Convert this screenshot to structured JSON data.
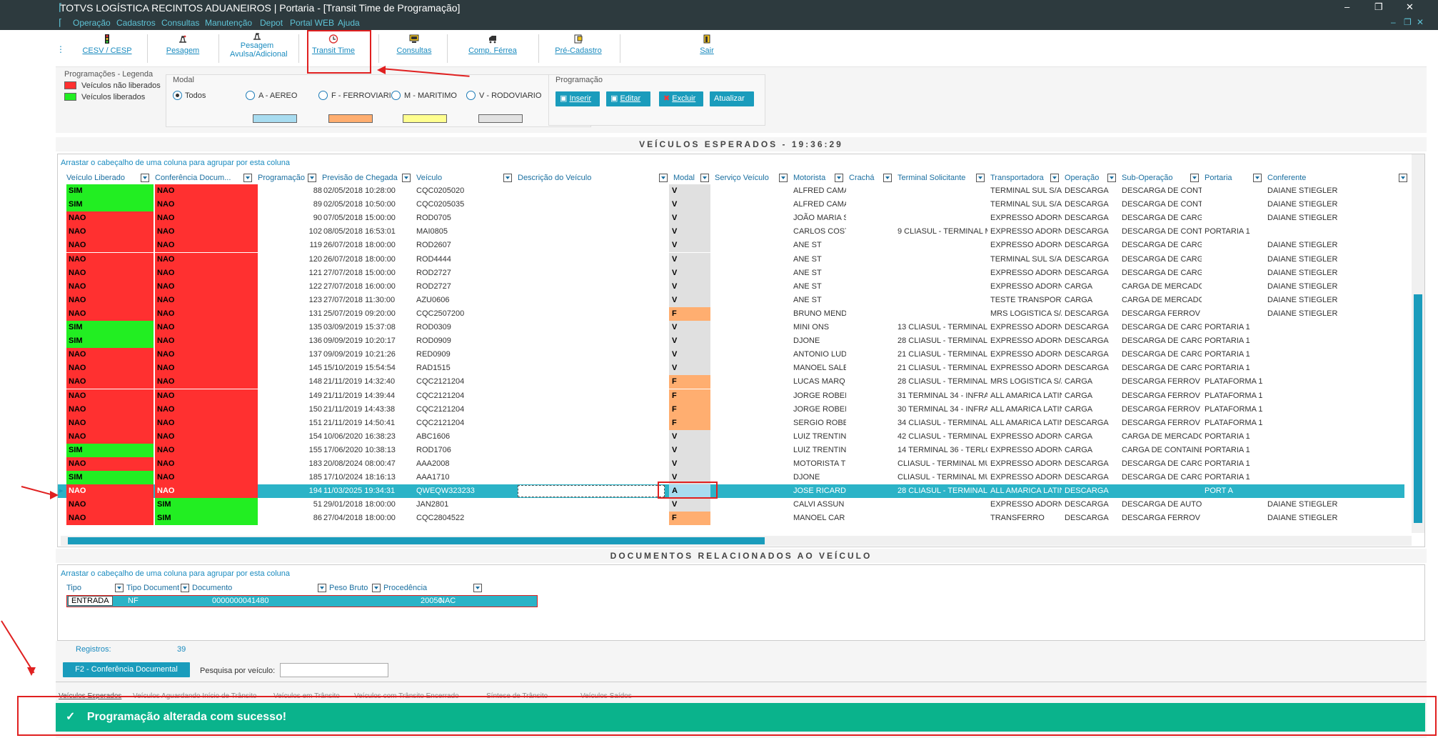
{
  "window": {
    "title": "TOTVS LOGÍSTICA RECINTOS ADUANEIROS | Portaria - [Transit Time de Programação]",
    "min": "–",
    "max": "❐",
    "close": "✕"
  },
  "menu": [
    "Operação",
    "Cadastros",
    "Consultas",
    "Manutenção",
    "Depot",
    "Portal WEB",
    "Ajuda"
  ],
  "toolbar": [
    {
      "label": "CESV / CESP",
      "icon": "traffic-light-icon"
    },
    {
      "label": "Pesagem",
      "icon": "scale-icon"
    },
    {
      "label": "Pesagem Avulsa/Adicional",
      "icon": "scale-icon"
    },
    {
      "label": "Transit Time",
      "icon": "clock-icon"
    },
    {
      "label": "Consultas",
      "icon": "monitor-icon"
    },
    {
      "label": "Comp. Férrea",
      "icon": "train-icon"
    },
    {
      "label": "Pré-Cadastro",
      "icon": "form-icon"
    },
    {
      "label": "Sair",
      "icon": "exit-icon"
    }
  ],
  "legend": {
    "title": "Programações - Legenda",
    "not_released": "Veículos não liberados",
    "released": "Veículos liberados",
    "red": "#ff3030",
    "green": "#22ee22"
  },
  "modal": {
    "title": "Modal",
    "options": [
      "Todos",
      "A - AEREO",
      "F - FERROVIARIO",
      "M - MARITIMO",
      "V - RODOVIARIO"
    ],
    "selected": "Todos",
    "colors": [
      "#a8dcf0",
      "#ffae70",
      "#ffff90",
      "#e2e2e2"
    ]
  },
  "programacao": {
    "title": "Programação",
    "insert": "Inserir",
    "edit": "Editar",
    "delete": "Excluir",
    "refresh": "Atualizar"
  },
  "vehicles_header": "VEÍCULOS ESPERADOS - 19:36:29",
  "group_hint": "Arrastar o cabeçalho de uma coluna para agrupar por esta coluna",
  "columns": [
    "Veículo Liberado",
    "Conferência Docum...",
    "Programação",
    "Previsão de Chegada",
    "Veículo",
    "Descrição do Veículo",
    "Modal",
    "Serviço Veículo",
    "Motorista",
    "Crachá",
    "Terminal Solicitante",
    "Transportadora",
    "Operação",
    "Sub-Operação",
    "Portaria",
    "Conferente"
  ],
  "rows": [
    [
      "SIM",
      "NAO",
      "88",
      "02/05/2018 10:28:00",
      "CQC0205020",
      "",
      "V",
      "",
      "ALFRED CAMA",
      "",
      "",
      "TERMINAL SUL S/A",
      "DESCARGA",
      "DESCARGA DE CONTI",
      "",
      "DAIANE STIEGLER"
    ],
    [
      "SIM",
      "NAO",
      "89",
      "02/05/2018 10:50:00",
      "CQC0205035",
      "",
      "V",
      "",
      "ALFRED CAMA",
      "",
      "",
      "TERMINAL SUL S/A",
      "DESCARGA",
      "DESCARGA DE CONTI",
      "",
      "DAIANE STIEGLER"
    ],
    [
      "NAO",
      "NAO",
      "90",
      "07/05/2018 15:00:00",
      "ROD0705",
      "",
      "V",
      "",
      "JOÃO MARIA S",
      "",
      "",
      "EXPRESSO ADORN",
      "DESCARGA",
      "DESCARGA DE CARGA",
      "",
      "DAIANE STIEGLER"
    ],
    [
      "NAO",
      "NAO",
      "102",
      "08/05/2018 16:53:01",
      "MAI0805",
      "",
      "V",
      "",
      "CARLOS COST",
      "",
      "9 CLIASUL - TERMINAL MU",
      "EXPRESSO ADORN",
      "DESCARGA",
      "DESCARGA DE CONTI",
      "PORTARIA 1",
      ""
    ],
    [
      "NAO",
      "NAO",
      "119",
      "26/07/2018 18:00:00",
      "ROD2607",
      "",
      "V",
      "",
      "ANE ST",
      "",
      "",
      "EXPRESSO ADORN",
      "DESCARGA",
      "DESCARGA DE CARGA",
      "",
      "DAIANE STIEGLER"
    ],
    [
      "NAO",
      "NAO",
      "120",
      "26/07/2018 18:00:00",
      "ROD4444",
      "",
      "V",
      "",
      "ANE ST",
      "",
      "",
      "TERMINAL SUL S/A",
      "DESCARGA",
      "DESCARGA DE CARGA",
      "",
      "DAIANE STIEGLER"
    ],
    [
      "NAO",
      "NAO",
      "121",
      "27/07/2018 15:00:00",
      "ROD2727",
      "",
      "V",
      "",
      "ANE ST",
      "",
      "",
      "EXPRESSO ADORN",
      "DESCARGA",
      "DESCARGA DE CARGA",
      "",
      "DAIANE STIEGLER"
    ],
    [
      "NAO",
      "NAO",
      "122",
      "27/07/2018 16:00:00",
      "ROD2727",
      "",
      "V",
      "",
      "ANE ST",
      "",
      "",
      "EXPRESSO ADORN",
      "CARGA",
      "CARGA DE MERCADO",
      "",
      "DAIANE STIEGLER"
    ],
    [
      "NAO",
      "NAO",
      "123",
      "27/07/2018 11:30:00",
      "AZU0606",
      "",
      "V",
      "",
      "ANE ST",
      "",
      "",
      "TESTE TRANSPORT",
      "CARGA",
      "CARGA DE MERCADO",
      "",
      "DAIANE STIEGLER"
    ],
    [
      "NAO",
      "NAO",
      "131",
      "25/07/2019 09:20:00",
      "CQC2507200",
      "",
      "F",
      "",
      "BRUNO MEND",
      "",
      "",
      "MRS LOGISTICA S/A",
      "DESCARGA",
      "DESCARGA FERROV I",
      "",
      "DAIANE STIEGLER"
    ],
    [
      "SIM",
      "NAO",
      "135",
      "03/09/2019 15:37:08",
      "ROD0309",
      "",
      "V",
      "",
      "MINI ONS",
      "",
      "13 CLIASUL - TERMINAL MU",
      "EXPRESSO ADORN",
      "DESCARGA",
      "DESCARGA DE CARGA",
      "PORTARIA 1",
      ""
    ],
    [
      "SIM",
      "NAO",
      "136",
      "09/09/2019 10:20:17",
      "ROD0909",
      "",
      "V",
      "",
      "DJONE",
      "",
      "28 CLIASUL - TERMINAL MU",
      "EXPRESSO ADORN",
      "DESCARGA",
      "DESCARGA DE CARGA",
      "PORTARIA 1",
      ""
    ],
    [
      "NAO",
      "NAO",
      "137",
      "09/09/2019 10:21:26",
      "RED0909",
      "",
      "V",
      "",
      "ANTONIO LUD",
      "",
      "21 CLIASUL - TERMINAL MU",
      "EXPRESSO ADORN",
      "DESCARGA",
      "DESCARGA DE CARGA",
      "PORTARIA 1",
      ""
    ],
    [
      "NAO",
      "NAO",
      "145",
      "15/10/2019 15:54:54",
      "RAD1515",
      "",
      "V",
      "",
      "MANOEL SALE",
      "",
      "21 CLIASUL - TERMINAL MU",
      "EXPRESSO ADORN",
      "DESCARGA",
      "DESCARGA DE CARGA",
      "PORTARIA 1",
      ""
    ],
    [
      "NAO",
      "NAO",
      "148",
      "21/11/2019 14:32:40",
      "CQC2121204",
      "",
      "F",
      "",
      "LUCAS MARQ",
      "",
      "28 CLIASUL - TERMINAL MU",
      "MRS LOGISTICA S/A",
      "CARGA",
      "DESCARGA FERROV (",
      "PLATAFORMA 1",
      ""
    ],
    [
      "NAO",
      "NAO",
      "149",
      "21/11/2019 14:39:44",
      "CQC2121204",
      "",
      "F",
      "",
      "JORGE ROBEI",
      "",
      "31 TERMINAL 34 - INFRALOI",
      "ALL AMARICA LATIN",
      "CARGA",
      "DESCARGA FERROV (",
      "PLATAFORMA 1",
      ""
    ],
    [
      "NAO",
      "NAO",
      "150",
      "21/11/2019 14:43:38",
      "CQC2121204",
      "",
      "F",
      "",
      "JORGE ROBEI",
      "",
      "30 TERMINAL 34 - INFRALOI",
      "ALL AMARICA LATIN",
      "CARGA",
      "DESCARGA FERROV (",
      "PLATAFORMA 1",
      ""
    ],
    [
      "NAO",
      "NAO",
      "151",
      "21/11/2019 14:50:41",
      "CQC2121204",
      "",
      "F",
      "",
      "SERGIO ROBE",
      "",
      "34 CLIASUL - TERMINAL MU",
      "ALL AMARICA LATIN",
      "DESCARGA",
      "DESCARGA FERROV (",
      "PLATAFORMA 1",
      ""
    ],
    [
      "NAO",
      "NAO",
      "154",
      "10/06/2020 16:38:23",
      "ABC1606",
      "",
      "V",
      "",
      "LUIZ TRENTIN",
      "",
      "42 CLIASUL - TERMINAL MU",
      "EXPRESSO ADORN",
      "CARGA",
      "CARGA DE MERCADO",
      "PORTARIA 1",
      ""
    ],
    [
      "SIM",
      "NAO",
      "155",
      "17/06/2020 10:38:13",
      "ROD1706",
      "",
      "V",
      "",
      "LUIZ TRENTIN",
      "",
      "14 TERMINAL 36 - TERLOG",
      "EXPRESSO ADORN",
      "CARGA",
      "CARGA DE CONTAINE",
      "PORTARIA 1",
      ""
    ],
    [
      "NAO",
      "NAO",
      "183",
      "20/08/2024 08:00:47",
      "AAA2008",
      "",
      "V",
      "",
      "MOTORISTA T",
      "",
      "CLIASUL - TERMINAL MU",
      "EXPRESSO ADORN",
      "DESCARGA",
      "DESCARGA DE CARGA",
      "PORTARIA 1",
      ""
    ],
    [
      "SIM",
      "NAO",
      "185",
      "17/10/2024 18:16:13",
      "AAA1710",
      "",
      "V",
      "",
      "DJONE",
      "",
      "CLIASUL - TERMINAL MU",
      "EXPRESSO ADORN",
      "DESCARGA",
      "DESCARGA DE CARGA",
      "PORTARIA 1",
      ""
    ],
    [
      "NAO",
      "NAO",
      "194",
      "11/03/2025 19:34:31",
      "QWEQW323233",
      "",
      "A",
      "",
      "JOSE RICARD",
      "",
      "28 CLIASUL - TERMINAL MU",
      "ALL AMARICA LATIN",
      "DESCARGA",
      "",
      "PORT A",
      ""
    ],
    [
      "NAO",
      "SIM",
      "51",
      "29/01/2018 18:00:00",
      "JAN2801",
      "",
      "V",
      "",
      "CALVI ASSUN",
      "",
      "",
      "EXPRESSO ADORN",
      "DESCARGA",
      "DESCARGA DE AUTOI",
      "",
      "DAIANE STIEGLER"
    ],
    [
      "NAO",
      "SIM",
      "86",
      "27/04/2018 18:00:00",
      "CQC2804522",
      "",
      "F",
      "",
      "MANOEL CAR",
      "",
      "",
      "TRANSFERRO",
      "DESCARGA",
      "DESCARGA FERROV N",
      "",
      "DAIANE STIEGLER"
    ]
  ],
  "selected_row": 22,
  "docs_header": "DOCUMENTOS RELACIONADOS AO VEÍCULO",
  "doc_columns": [
    "Tipo",
    "Tipo Documento",
    "Documento",
    "Peso Bruto",
    "Procedência"
  ],
  "doc_rows": [
    [
      "ENTRADA",
      "NF",
      "0000000041480",
      "20050",
      "NAC"
    ]
  ],
  "registros_label": "Registros:",
  "registros_value": "39",
  "conf_button": "F2 - Conferência Documental",
  "search_label": "Pesquisa por veículo:",
  "search_value": "",
  "bottom_tabs": [
    "Veículos Esperados",
    "Veículos Aguardando Início de Trânsito",
    "Veículos em Trânsito",
    "Veículos com Trânsito Encerrado",
    "Síntese de Trânsito",
    "Veículos Saídos"
  ],
  "toast": "Programação alterada com sucesso!",
  "status_colors": {
    "red": "#ff3030",
    "green": "#22ee22",
    "selected": "#2bb3c7",
    "modal_f": "#ffae70",
    "modal_v": "#e0e0e0",
    "modal_a": "#a8dcf0",
    "accent": "#1a9cbc",
    "toast": "#0ab38c"
  }
}
